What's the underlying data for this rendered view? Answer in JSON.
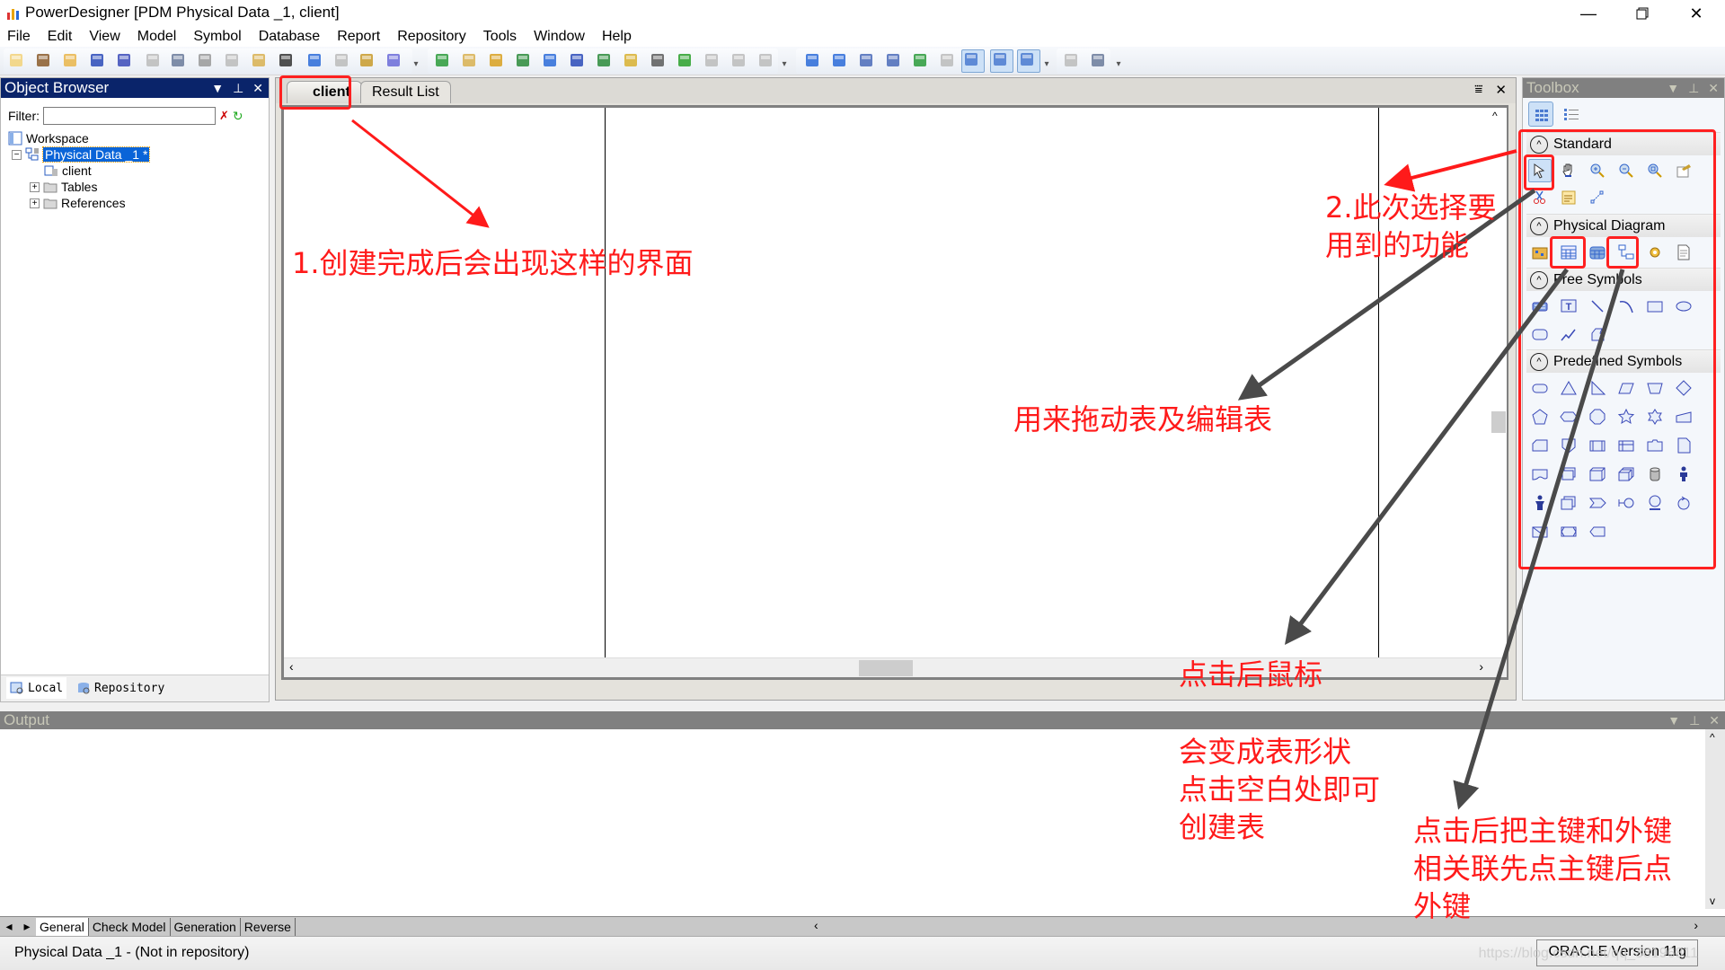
{
  "window": {
    "title": "PowerDesigner [PDM Physical Data _1, client]",
    "controls": [
      "minimize",
      "restore",
      "close"
    ]
  },
  "menu": [
    "File",
    "Edit",
    "View",
    "Model",
    "Symbol",
    "Database",
    "Report",
    "Repository",
    "Tools",
    "Window",
    "Help"
  ],
  "toolbar": {
    "icons": [
      "new-icon",
      "new-project-icon",
      "open-icon",
      "save-icon",
      "save-all-icon",
      "print-preview-icon",
      "print-icon",
      "cut-icon",
      "copy-icon",
      "paste-icon",
      "delete-icon",
      "undo-icon",
      "redo-icon",
      "properties-icon",
      "help-icon",
      "new-model-icon",
      "paste-as-shortcut-icon",
      "find-icon",
      "refresh-icon",
      "check-model-icon",
      "shadow-icon",
      "text-icon",
      "pen-icon",
      "fill-icon",
      "font-color-icon",
      "bring-to-front-icon",
      "send-back-icon",
      "send-forward-icon",
      "auto-layout-icon",
      "group-layout-icon",
      "page-icon",
      "pages-icon",
      "merge-icon",
      "disabled-icon",
      "zoom-view-icon",
      "comment-icon",
      "table-view-icon",
      "print-preview-2-icon",
      "print-2-icon"
    ]
  },
  "object_browser": {
    "title": "Object Browser",
    "filter_label": "Filter:",
    "filter_value": "",
    "tree": [
      {
        "label": "Workspace",
        "level": 0
      },
      {
        "label": "Physical Data _1 *",
        "level": 1,
        "selected": true,
        "expanded": true
      },
      {
        "label": "client",
        "level": 2
      },
      {
        "label": "Tables",
        "level": 2,
        "collapsed": true
      },
      {
        "label": "References",
        "level": 2,
        "collapsed": true
      }
    ],
    "tabs": [
      "Local",
      "Repository"
    ]
  },
  "diagram": {
    "tabs": [
      {
        "label": "client",
        "active": true
      },
      {
        "label": "Result List",
        "active": false
      }
    ]
  },
  "toolbox": {
    "title": "Toolbox",
    "categories": [
      {
        "label": "Standard",
        "tools": [
          "pointer",
          "grabber",
          "zoom-in",
          "zoom-out",
          "zoom-to-fit",
          "properties",
          "delete",
          "note",
          "link"
        ]
      },
      {
        "label": "Physical Diagram",
        "tools": [
          "package",
          "table",
          "view",
          "reference",
          "procedure",
          "file"
        ]
      },
      {
        "label": "Free Symbols",
        "tools": [
          "title",
          "text",
          "line",
          "arc",
          "rectangle",
          "ellipse",
          "rounded-rectangle",
          "polyline",
          "polygon"
        ]
      },
      {
        "label": "Predefined Symbols",
        "tools": [
          "rounded-rect",
          "triangle",
          "right-triangle",
          "parallelogram",
          "trapezoid",
          "diamond",
          "pentagon",
          "hexagon",
          "octagon",
          "star",
          "star6",
          "manual-input",
          "card",
          "offpage",
          "internal-storage",
          "header-box",
          "folder",
          "document",
          "punched-tape",
          "multi-document",
          "cube",
          "stacked-cube",
          "cylinder",
          "actor",
          "actor2",
          "stack",
          "chevron",
          "interface",
          "receiver",
          "control",
          "envelope",
          "display",
          "tag"
        ]
      }
    ]
  },
  "output": {
    "title": "Output",
    "tabs": [
      "General",
      "Check Model",
      "Generation",
      "Reverse"
    ],
    "active_tab": "General"
  },
  "statusbar": {
    "left": "Physical Data _1 - (Not in repository)",
    "right": "ORACLE Version 11g",
    "watermark": "https://blog.csdn.net/qq_38196811"
  },
  "annotations": {
    "a1": "1.创建完成后会出现这样的界面",
    "a2_line1": "2.此次选择要",
    "a2_line2": "用到的功能",
    "a3": "用来拖动表及编辑表",
    "a4": "点击后鼠标",
    "a5_line1": "会变成表形状",
    "a5_line2": "点击空白处即可",
    "a5_line3": "创建表",
    "a6_line1": "点击后把主键和外键",
    "a6_line2": "相关联先点主键后点",
    "a6_line3": "外键"
  },
  "colors": {
    "annotation_red": "#ff1a1a",
    "active_panel": "#0a246a",
    "inactive_panel": "#808080",
    "selection": "#0a64d8"
  }
}
